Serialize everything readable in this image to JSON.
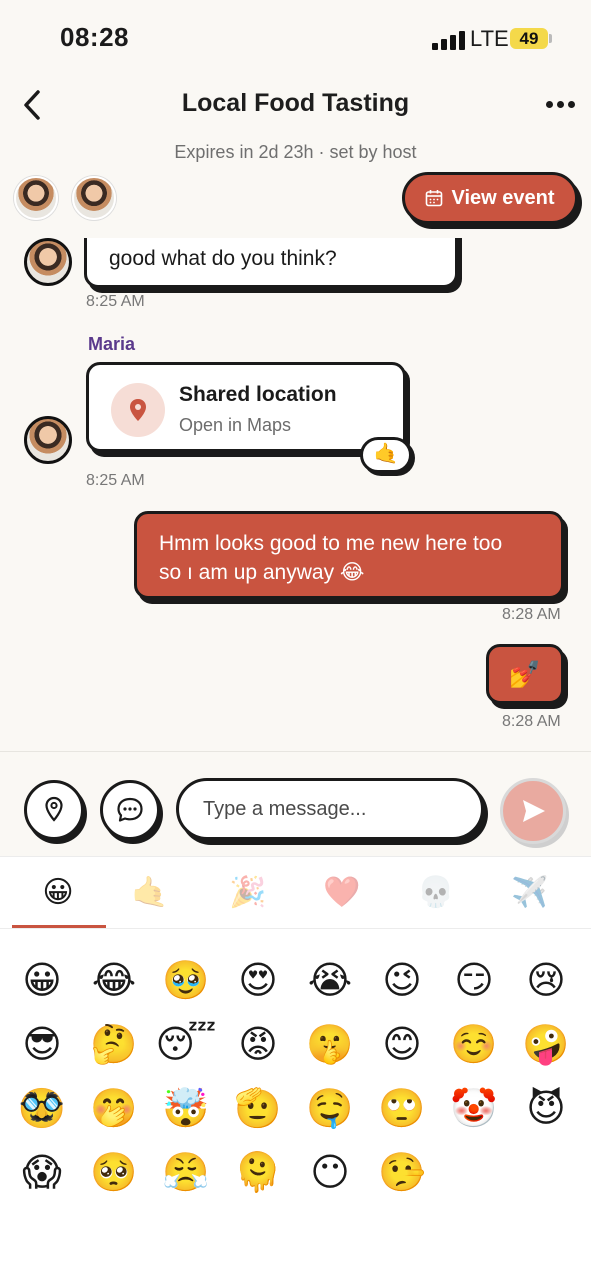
{
  "status_bar": {
    "time": "08:28",
    "network": "LTE",
    "battery": "49"
  },
  "header": {
    "title": "Local Food Tasting",
    "expires": "Expires in 2d 23h · set by host",
    "view_event_label": "View event"
  },
  "messages": {
    "first_text": "good what do you think?",
    "first_time": "8:25 AM",
    "location_sender": "Maria",
    "location_title": "Shared location",
    "location_subtitle": "Open in Maps",
    "location_reaction": "🤙",
    "location_time": "8:25 AM",
    "out1_text_line1": "Hmm looks good to me new here too",
    "out1_text_line2": "so ı am up anyway 😂",
    "out1_time": "8:28 AM",
    "out2_text": "💅",
    "out2_time": "8:28 AM"
  },
  "composer": {
    "placeholder": "Type a message..."
  },
  "emoji_picker": {
    "categories": [
      "😀",
      "🤙",
      "🎉",
      "❤️",
      "💀",
      "✈️"
    ],
    "emojis": [
      "😀",
      "😂",
      "🥹",
      "😍",
      "😭",
      "😉",
      "😏",
      "😢",
      "😎",
      "🤔",
      "😴",
      "😡",
      "🤫",
      "😊",
      "☺️",
      "🤪",
      "🥸",
      "🤭",
      "🤯",
      "🫡",
      "🤤",
      "🙄",
      "🤡",
      "😈",
      "😱",
      "🥺",
      "😤",
      "🫠",
      "😶",
      "🤥"
    ]
  },
  "colors": {
    "accent": "#c95440",
    "sender_name": "#5b3a8c",
    "background": "#faf8f4"
  }
}
